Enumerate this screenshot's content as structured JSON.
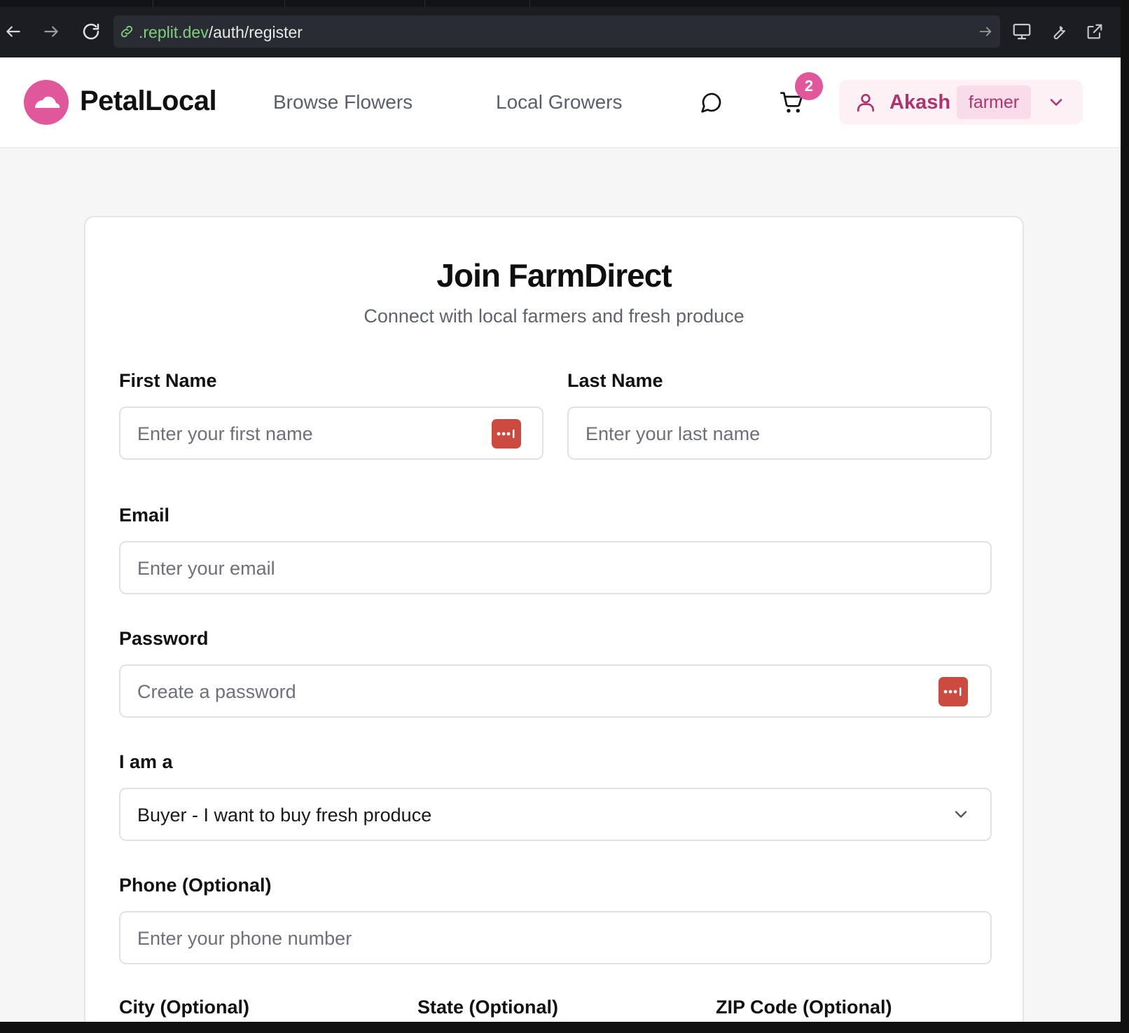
{
  "browser": {
    "url_domain": ".replit.dev",
    "url_path": "/auth/register"
  },
  "header": {
    "brand": "PetalLocal",
    "nav": [
      "Browse Flowers",
      "Local Growers"
    ],
    "cart_count": "2",
    "user_name": "Akash",
    "user_role": "farmer"
  },
  "form": {
    "title": "Join FarmDirect",
    "subtitle": "Connect with local farmers and fresh produce",
    "first_name": {
      "label": "First Name",
      "placeholder": "Enter your first name"
    },
    "last_name": {
      "label": "Last Name",
      "placeholder": "Enter your last name"
    },
    "email": {
      "label": "Email",
      "placeholder": "Enter your email"
    },
    "password": {
      "label": "Password",
      "placeholder": "Create a password"
    },
    "role": {
      "label": "I am a",
      "value": "Buyer - I want to buy fresh produce"
    },
    "phone": {
      "label": "Phone (Optional)",
      "placeholder": "Enter your phone number"
    },
    "city": {
      "label": "City (Optional)"
    },
    "state": {
      "label": "State (Optional)"
    },
    "zip": {
      "label": "ZIP Code (Optional)"
    }
  },
  "colors": {
    "accent": "#e0579c",
    "accent_dark": "#b0326e",
    "password_manager": "#cc4a3f"
  }
}
